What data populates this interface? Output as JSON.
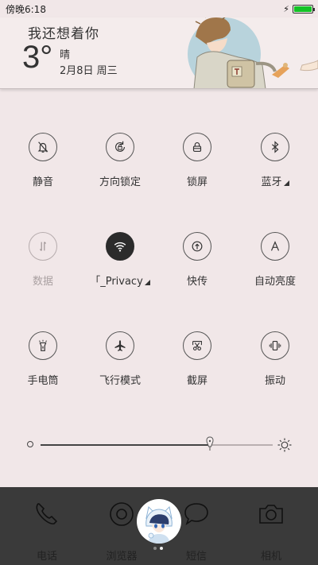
{
  "status_bar": {
    "time": "傍晚6:18",
    "battery_level": 1.0,
    "battery_color": "#13c326"
  },
  "weather": {
    "greeting": "我还想着你",
    "temperature": "3°",
    "condition": "晴",
    "date": "2月8日 周三"
  },
  "toggles": [
    {
      "id": "mute",
      "label": "静音",
      "icon": "bell-off-icon",
      "state": "off"
    },
    {
      "id": "rotation-lock",
      "label": "方向锁定",
      "icon": "rotation-lock-icon",
      "state": "off"
    },
    {
      "id": "lock-screen",
      "label": "锁屏",
      "icon": "lock-icon",
      "state": "off"
    },
    {
      "id": "bluetooth",
      "label": "蓝牙",
      "icon": "bluetooth-icon",
      "state": "off",
      "expandable": true
    },
    {
      "id": "mobile-data",
      "label": "数据",
      "icon": "data-arrows-icon",
      "state": "disabled"
    },
    {
      "id": "wifi",
      "label": "「_Privacy",
      "icon": "wifi-icon",
      "state": "on",
      "expandable": true
    },
    {
      "id": "quick-share",
      "label": "快传",
      "icon": "upload-icon",
      "state": "off"
    },
    {
      "id": "auto-brightness",
      "label": "自动亮度",
      "icon": "auto-a-icon",
      "state": "off"
    },
    {
      "id": "flashlight",
      "label": "手电筒",
      "icon": "flashlight-icon",
      "state": "off"
    },
    {
      "id": "airplane",
      "label": "飞行模式",
      "icon": "airplane-icon",
      "state": "off"
    },
    {
      "id": "screenshot",
      "label": "截屏",
      "icon": "scissors-icon",
      "state": "off"
    },
    {
      "id": "vibrate",
      "label": "振动",
      "icon": "vibrate-icon",
      "state": "off"
    }
  ],
  "brightness": {
    "level": 0.73
  },
  "dock": {
    "items": [
      {
        "id": "phone",
        "label": "电话",
        "icon": "phone-icon"
      },
      {
        "id": "browser",
        "label": "浏览器",
        "icon": "browser-icon"
      },
      {
        "id": "sms",
        "label": "短信",
        "icon": "chat-bubble-icon"
      },
      {
        "id": "camera",
        "label": "相机",
        "icon": "camera-icon"
      }
    ],
    "page_dots": 2,
    "active_page": 1
  }
}
